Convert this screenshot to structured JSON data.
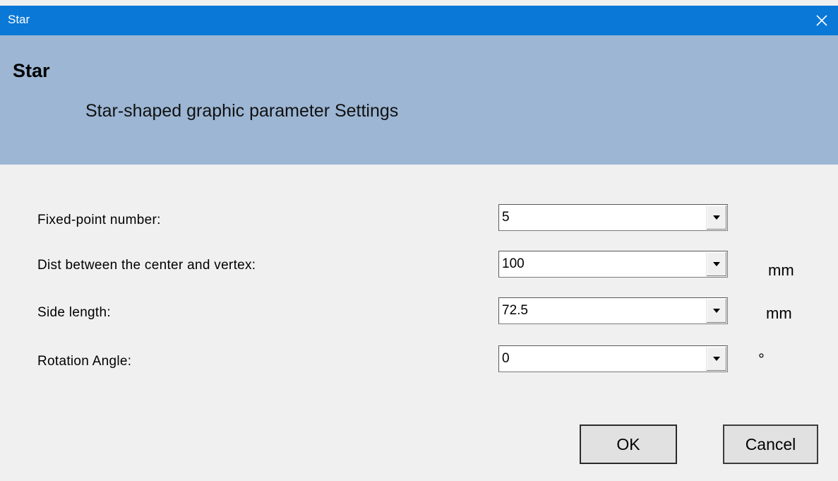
{
  "window": {
    "title": "Star",
    "close_icon": "close-icon"
  },
  "header": {
    "heading": "Star",
    "subheading": "Star-shaped graphic parameter Settings"
  },
  "fields": [
    {
      "label": "Fixed-point number:",
      "value": "5",
      "unit": ""
    },
    {
      "label": "Dist between the center and vertex:",
      "value": "100",
      "unit": "mm"
    },
    {
      "label": "Side length:",
      "value": "72.5",
      "unit": "mm"
    },
    {
      "label": "Rotation Angle:",
      "value": "0",
      "unit": "°"
    }
  ],
  "buttons": {
    "ok_label": "OK",
    "cancel_label": "Cancel"
  },
  "colors": {
    "titlebar": "#0a78d7",
    "header_band": "#9cb6d4",
    "dialog_bg": "#f0f0f0"
  }
}
